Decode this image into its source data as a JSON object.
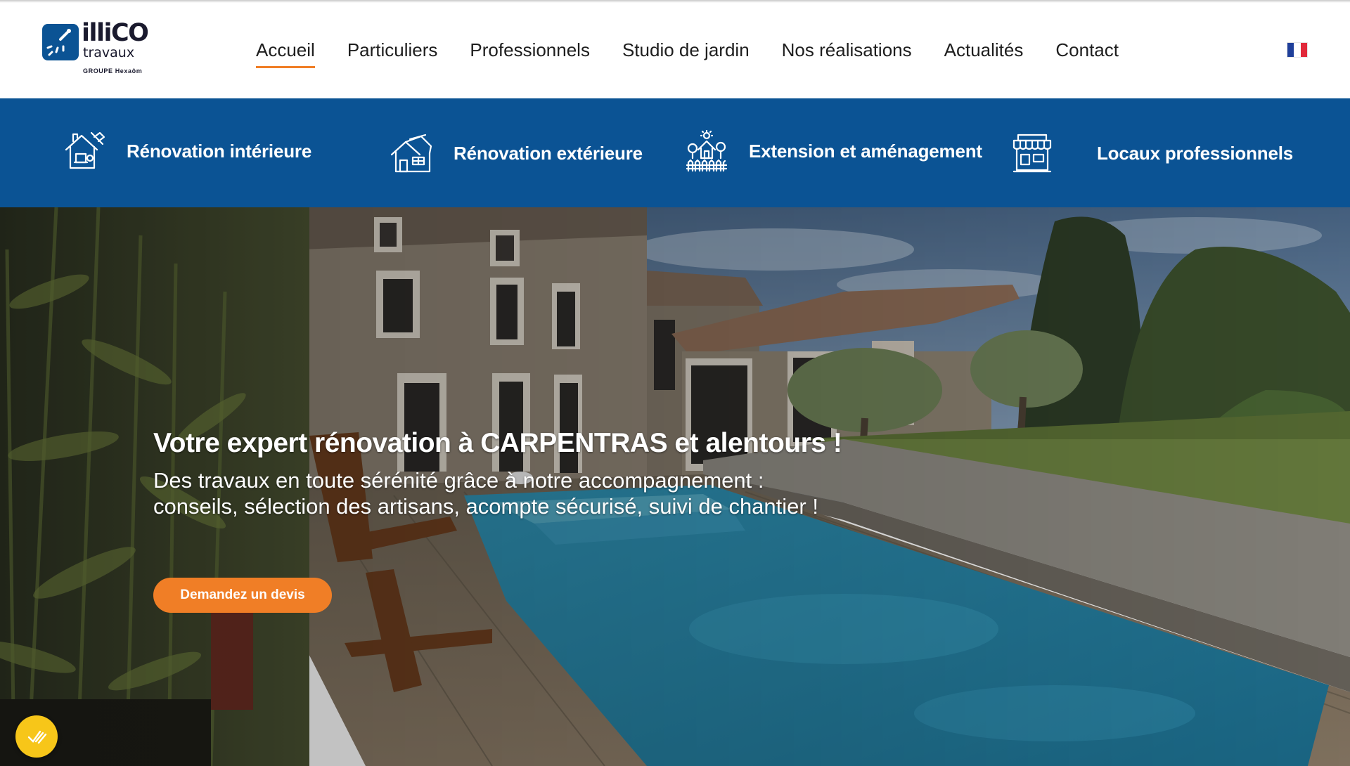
{
  "logo": {
    "brand": "illiCO",
    "sub": "travaux",
    "group": "GROUPE Hexaôm",
    "icon": "logo-mark-icon"
  },
  "nav": {
    "items": [
      {
        "label": "Accueil",
        "active": true
      },
      {
        "label": "Particuliers",
        "active": false
      },
      {
        "label": "Professionnels",
        "active": false
      },
      {
        "label": "Studio de jardin",
        "active": false
      },
      {
        "label": "Nos réalisations",
        "active": false
      },
      {
        "label": "Actualités",
        "active": false
      },
      {
        "label": "Contact",
        "active": false
      }
    ],
    "language_icon": "french-flag-icon"
  },
  "categories": [
    {
      "label": "Rénovation intérieure",
      "icon": "interior-renovation-icon"
    },
    {
      "label": "Rénovation extérieure",
      "icon": "exterior-renovation-icon"
    },
    {
      "label": "Extension et aménagement",
      "icon": "extension-icon"
    },
    {
      "label": "Locaux professionnels",
      "icon": "shop-icon"
    }
  ],
  "hero": {
    "title": "Votre expert rénovation à CARPENTRAS et alentours !",
    "subtitle_line1": "Des travaux en toute sérénité grâce à notre accompagnement :",
    "subtitle_line2": "conseils, sélection des artisans, acompte sécurisé, suivi de chantier !",
    "cta_label": "Demandez un devis",
    "image": "photo of renovated stone house with swimming pool, wooden deck and garden"
  },
  "consent_icon": "cookie-consent-icon",
  "colors": {
    "brand_blue": "#0b5394",
    "accent_orange": "#f07e26",
    "consent_yellow": "#f7c619",
    "nav_text": "#1e1e1e"
  }
}
